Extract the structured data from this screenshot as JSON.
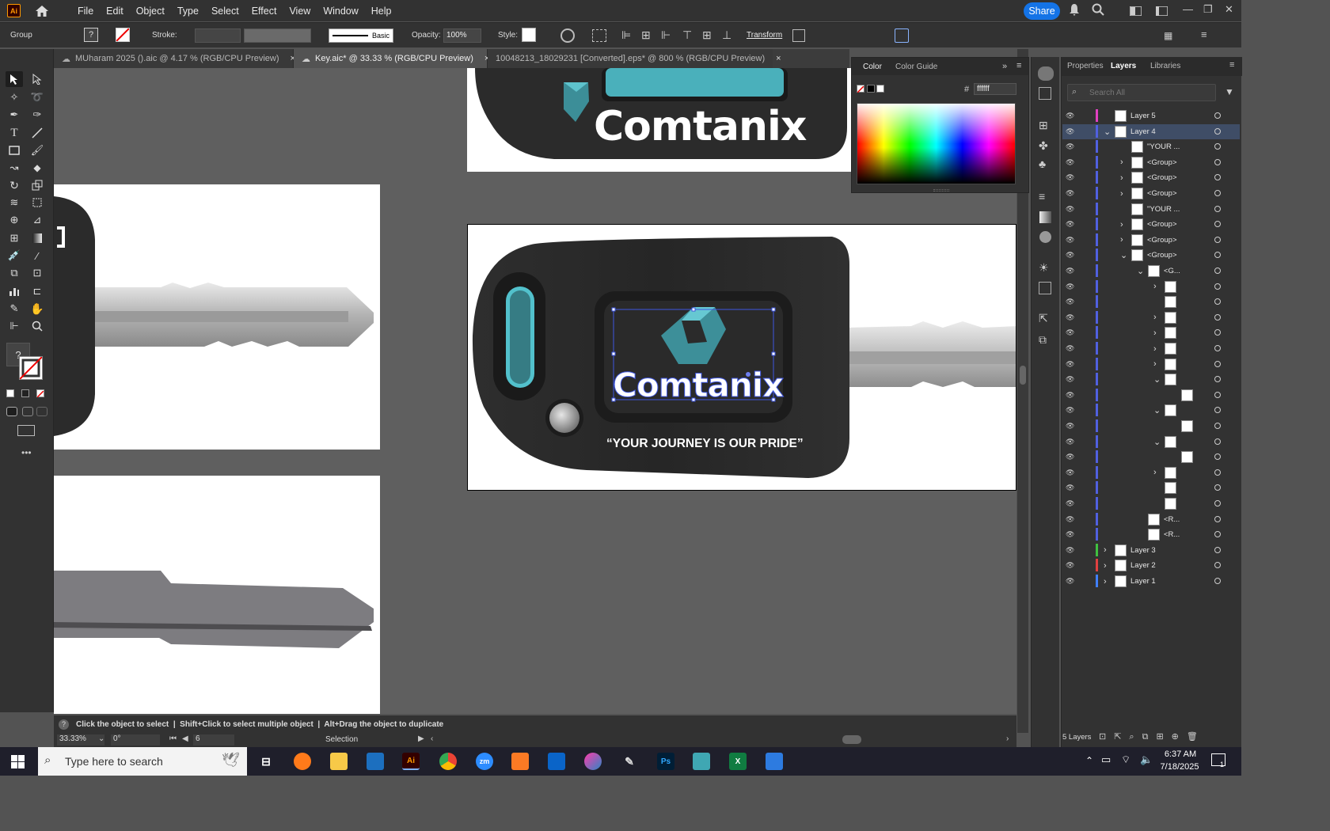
{
  "app": {
    "logo": "Ai",
    "menus": [
      "File",
      "Edit",
      "Object",
      "Type",
      "Select",
      "Effect",
      "View",
      "Window",
      "Help"
    ],
    "share_label": "Share"
  },
  "control": {
    "selection_type": "Group",
    "stroke_label": "Stroke:",
    "brush_label": "Basic",
    "opacity_label": "Opacity:",
    "opacity_value": "100%",
    "style_label": "Style:",
    "transform_label": "Transform"
  },
  "tabs": [
    {
      "label": "MUharam 2025 ().aic @ 4.17 % (RGB/CPU Preview)",
      "close": "×"
    },
    {
      "label": "Key.aic* @ 33.33 % (RGB/CPU Preview)",
      "close": "×"
    },
    {
      "label": "10048213_18029231 [Converted].eps* @ 800 % (RGB/CPU Preview)",
      "close": "×"
    }
  ],
  "artwork": {
    "brand": "Comtanix",
    "slogan": "“YOUR JOURNEY IS OUR PRIDE”"
  },
  "color_panel": {
    "tab_color": "Color",
    "tab_guide": "Color Guide",
    "hash": "#",
    "hex": "ffffff"
  },
  "layers_panel": {
    "tabs": [
      "Properties",
      "Layers",
      "Libraries"
    ],
    "search_placeholder": "Search All",
    "rows": [
      {
        "name": "Layer 5",
        "indent": 0,
        "color": "#e040c0",
        "arrow": ""
      },
      {
        "name": "Layer 4",
        "indent": 0,
        "color": "#5060e0",
        "arrow": "v",
        "selected": true
      },
      {
        "name": "\"YOUR ...",
        "indent": 1,
        "color": "#5060e0",
        "arrow": ""
      },
      {
        "name": "<Group>",
        "indent": 1,
        "color": "#5060e0",
        "arrow": ">"
      },
      {
        "name": "<Group>",
        "indent": 1,
        "color": "#5060e0",
        "arrow": ">"
      },
      {
        "name": "<Group>",
        "indent": 1,
        "color": "#5060e0",
        "arrow": ">"
      },
      {
        "name": "\"YOUR ...",
        "indent": 1,
        "color": "#5060e0",
        "arrow": ""
      },
      {
        "name": "<Group>",
        "indent": 1,
        "color": "#5060e0",
        "arrow": ">"
      },
      {
        "name": "<Group>",
        "indent": 1,
        "color": "#5060e0",
        "arrow": ">"
      },
      {
        "name": "<Group>",
        "indent": 1,
        "color": "#5060e0",
        "arrow": "v"
      },
      {
        "name": "<G...",
        "indent": 2,
        "color": "#5060e0",
        "arrow": "v"
      },
      {
        "name": "",
        "indent": 3,
        "color": "#5060e0",
        "arrow": ">"
      },
      {
        "name": "",
        "indent": 3,
        "color": "#5060e0",
        "arrow": ""
      },
      {
        "name": "",
        "indent": 3,
        "color": "#5060e0",
        "arrow": ">"
      },
      {
        "name": "",
        "indent": 3,
        "color": "#5060e0",
        "arrow": ">"
      },
      {
        "name": "",
        "indent": 3,
        "color": "#5060e0",
        "arrow": ">"
      },
      {
        "name": "",
        "indent": 3,
        "color": "#5060e0",
        "arrow": ">"
      },
      {
        "name": "",
        "indent": 3,
        "color": "#5060e0",
        "arrow": "v"
      },
      {
        "name": "",
        "indent": 4,
        "color": "#5060e0",
        "arrow": ""
      },
      {
        "name": "",
        "indent": 3,
        "color": "#5060e0",
        "arrow": "v"
      },
      {
        "name": "",
        "indent": 4,
        "color": "#5060e0",
        "arrow": ""
      },
      {
        "name": "",
        "indent": 3,
        "color": "#5060e0",
        "arrow": "v"
      },
      {
        "name": "",
        "indent": 4,
        "color": "#5060e0",
        "arrow": ""
      },
      {
        "name": "",
        "indent": 3,
        "color": "#5060e0",
        "arrow": ">"
      },
      {
        "name": "",
        "indent": 3,
        "color": "#5060e0",
        "arrow": ""
      },
      {
        "name": "",
        "indent": 3,
        "color": "#5060e0",
        "arrow": ""
      },
      {
        "name": "<R...",
        "indent": 2,
        "color": "#5060e0",
        "arrow": ""
      },
      {
        "name": "<R...",
        "indent": 2,
        "color": "#5060e0",
        "arrow": ""
      },
      {
        "name": "Layer 3",
        "indent": 0,
        "color": "#40c040",
        "arrow": ">"
      },
      {
        "name": "Layer 2",
        "indent": 0,
        "color": "#e04040",
        "arrow": ">"
      },
      {
        "name": "Layer 1",
        "indent": 0,
        "color": "#4080ff",
        "arrow": ">"
      }
    ],
    "footer_count": "5 Layers"
  },
  "status": {
    "hint": "Click the object to select  |  Shift+Click to select multiple object  |  Alt+Drag the object to duplicate",
    "zoom": "33.33%",
    "rotation": "0°",
    "artboard_num": "6",
    "tool": "Selection"
  },
  "taskbar": {
    "search_placeholder": "Type here to search",
    "time": "6:37 AM",
    "date": "7/18/2025",
    "notif": "1"
  }
}
